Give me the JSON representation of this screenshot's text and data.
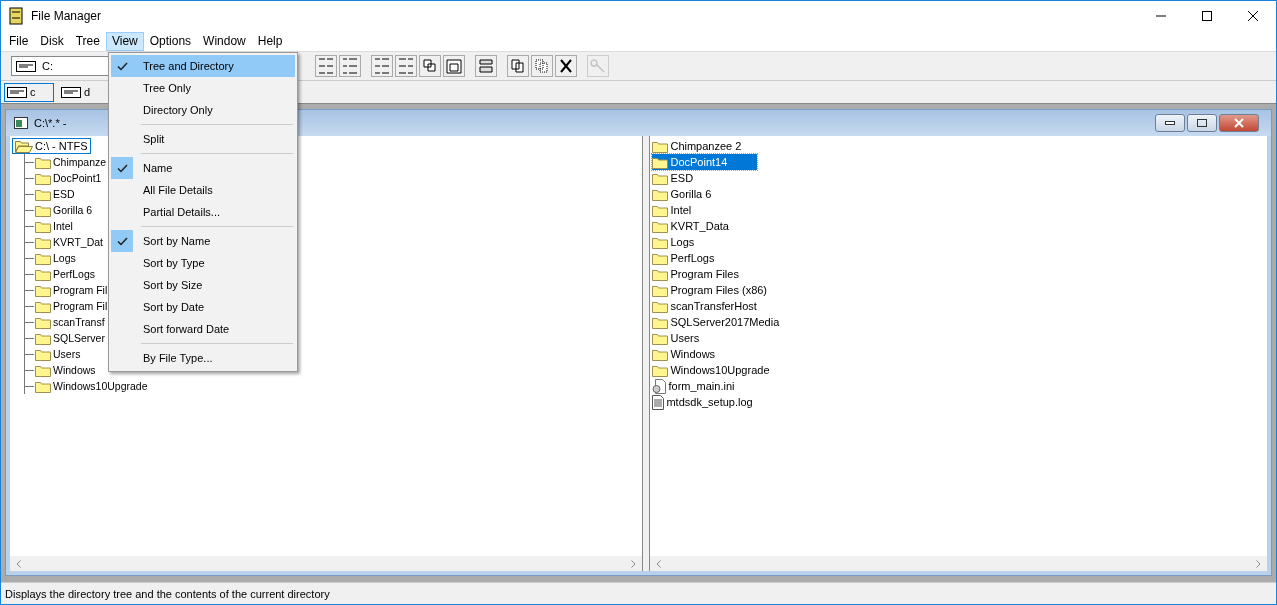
{
  "window": {
    "title": "File Manager"
  },
  "menu_bar": [
    {
      "label": "File",
      "selected": false
    },
    {
      "label": "Disk",
      "selected": false
    },
    {
      "label": "Tree",
      "selected": false
    },
    {
      "label": "View",
      "selected": true
    },
    {
      "label": "Options",
      "selected": false
    },
    {
      "label": "Window",
      "selected": false
    },
    {
      "label": "Help",
      "selected": false
    }
  ],
  "toolbar": {
    "drive": "C:",
    "buttons": [
      {
        "disabled": false
      },
      {
        "disabled": false
      },
      {
        "disabled": false
      },
      {
        "disabled": false
      },
      {
        "disabled": false
      },
      {
        "disabled": false
      },
      {
        "disabled": false
      },
      {
        "disabled": false
      },
      {
        "disabled": false
      },
      {
        "disabled": false
      },
      {
        "disabled": true
      }
    ]
  },
  "drives": [
    {
      "label": "c",
      "selected": true
    },
    {
      "label": "d",
      "selected": false
    }
  ],
  "child_window": {
    "title": "C:\\*.* -"
  },
  "tree": {
    "root": "C:\\ - NTFS",
    "children": [
      {
        "name": "Chimpanze"
      },
      {
        "name": "DocPoint1"
      },
      {
        "name": "ESD"
      },
      {
        "name": "Gorilla 6"
      },
      {
        "name": "Intel"
      },
      {
        "name": "KVRT_Dat"
      },
      {
        "name": "Logs"
      },
      {
        "name": "PerfLogs"
      },
      {
        "name": "Program Fil"
      },
      {
        "name": "Program Fil"
      },
      {
        "name": "scanTransf"
      },
      {
        "name": "SQLServer"
      },
      {
        "name": "Users"
      },
      {
        "name": "Windows"
      },
      {
        "name": "Windows10Upgrade"
      }
    ]
  },
  "files": [
    {
      "name": "Chimpanzee 2",
      "kind": "folder",
      "selected": false
    },
    {
      "name": "DocPoint14",
      "kind": "folder",
      "selected": true
    },
    {
      "name": "ESD",
      "kind": "folder",
      "selected": false
    },
    {
      "name": "Gorilla 6",
      "kind": "folder",
      "selected": false
    },
    {
      "name": "Intel",
      "kind": "folder",
      "selected": false
    },
    {
      "name": "KVRT_Data",
      "kind": "folder",
      "selected": false
    },
    {
      "name": "Logs",
      "kind": "folder",
      "selected": false
    },
    {
      "name": "PerfLogs",
      "kind": "folder",
      "selected": false
    },
    {
      "name": "Program Files",
      "kind": "folder",
      "selected": false
    },
    {
      "name": "Program Files (x86)",
      "kind": "folder",
      "selected": false
    },
    {
      "name": "scanTransferHost",
      "kind": "folder",
      "selected": false
    },
    {
      "name": "SQLServer2017Media",
      "kind": "folder",
      "selected": false
    },
    {
      "name": "Users",
      "kind": "folder",
      "selected": false
    },
    {
      "name": "Windows",
      "kind": "folder",
      "selected": false
    },
    {
      "name": "Windows10Upgrade",
      "kind": "folder",
      "selected": false
    },
    {
      "name": "form_main.ini",
      "kind": "settings",
      "selected": false
    },
    {
      "name": "mtdsdk_setup.log",
      "kind": "document",
      "selected": false
    }
  ],
  "view_menu": [
    {
      "kind": "item",
      "label": "Tree and Directory",
      "checked": true,
      "selected": true
    },
    {
      "kind": "item",
      "label": "Tree Only",
      "checked": false,
      "selected": false
    },
    {
      "kind": "item",
      "label": "Directory Only",
      "checked": false,
      "selected": false
    },
    {
      "kind": "separator"
    },
    {
      "kind": "item",
      "label": "Split",
      "checked": false,
      "selected": false
    },
    {
      "kind": "separator"
    },
    {
      "kind": "item",
      "label": "Name",
      "checked": true,
      "selected": false
    },
    {
      "kind": "item",
      "label": "All File Details",
      "checked": false,
      "selected": false
    },
    {
      "kind": "item",
      "label": "Partial Details...",
      "checked": false,
      "selected": false
    },
    {
      "kind": "separator"
    },
    {
      "kind": "item",
      "label": "Sort by Name",
      "checked": true,
      "selected": false
    },
    {
      "kind": "item",
      "label": "Sort by Type",
      "checked": false,
      "selected": false
    },
    {
      "kind": "item",
      "label": "Sort by Size",
      "checked": false,
      "selected": false
    },
    {
      "kind": "item",
      "label": "Sort by Date",
      "checked": false,
      "selected": false
    },
    {
      "kind": "item",
      "label": "Sort forward Date",
      "checked": false,
      "selected": false
    },
    {
      "kind": "separator"
    },
    {
      "kind": "item",
      "label": "By File Type...",
      "checked": false,
      "selected": false
    }
  ],
  "status_bar": "Displays the directory tree and the contents of the current directory"
}
